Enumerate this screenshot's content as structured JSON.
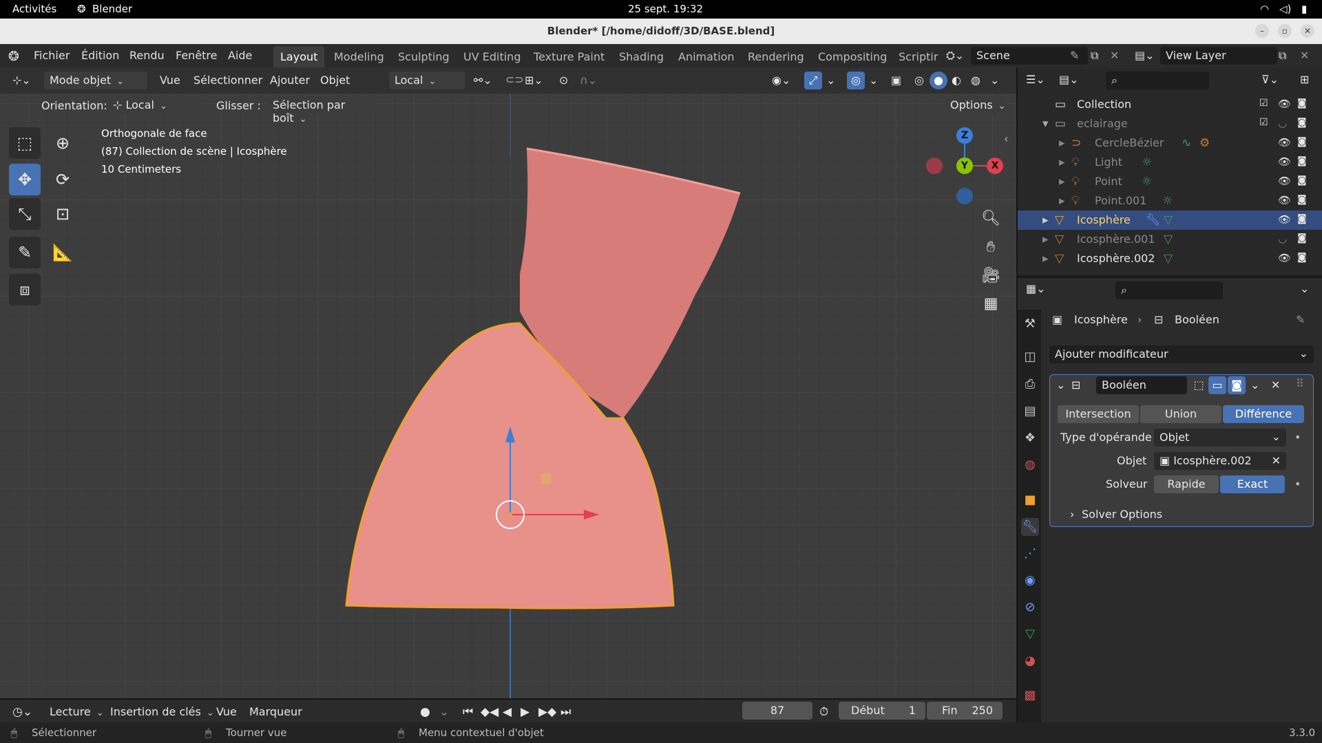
{
  "system_bar": {
    "activities": "Activités",
    "app": "Blender",
    "clock": "25 sept.  19:32"
  },
  "window": {
    "title": "Blender* [/home/didoff/3D/BASE.blend]"
  },
  "menu": {
    "items": [
      "Fichier",
      "Édition",
      "Rendu",
      "Fenêtre",
      "Aide"
    ]
  },
  "workspaces": {
    "tabs": [
      "Layout",
      "Modeling",
      "Sculpting",
      "UV Editing",
      "Texture Paint",
      "Shading",
      "Animation",
      "Rendering",
      "Compositing",
      "Scriptir"
    ],
    "active": "Layout"
  },
  "scene": {
    "name": "Scene",
    "view_layer": "View Layer"
  },
  "viewport_header": {
    "mode": "Mode objet",
    "menus": [
      "Vue",
      "Sélectionner",
      "Ajouter",
      "Objet"
    ],
    "transform_orientation": "Local",
    "orientation_label": "Orientation:",
    "orientation_value": "Local",
    "drag_label": "Glisser :",
    "drag_value": "Sélection par boît",
    "options": "Options"
  },
  "viewport_overlay": {
    "view_name": "Orthogonale de face",
    "collection_info": "(87) Collection de scène | Icosphère",
    "scale_info": "10 Centimeters"
  },
  "gizmo": {
    "z": "Z",
    "y": "Y",
    "x": "X"
  },
  "colors": {
    "accent": "#4772b3",
    "selection": "#334d80",
    "mesh": "#e8908a",
    "outline": "#f0a030",
    "axis_x": "#e04050",
    "axis_y": "#8ac400",
    "axis_z": "#3a80d8"
  },
  "outliner": {
    "rows": [
      {
        "name": "Collection",
        "icon": "collection-icon"
      },
      {
        "name": "eclairage",
        "icon": "collection-icon"
      },
      {
        "name": "CercleBézier",
        "icon": "curve-icon"
      },
      {
        "name": "Light",
        "icon": "light-icon"
      },
      {
        "name": "Point",
        "icon": "light-icon"
      },
      {
        "name": "Point.001",
        "icon": "light-icon"
      },
      {
        "name": "Icosphère",
        "icon": "mesh-icon"
      },
      {
        "name": "Icosphère.001",
        "icon": "mesh-icon"
      },
      {
        "name": "Icosphère.002",
        "icon": "mesh-icon"
      }
    ]
  },
  "properties": {
    "breadcrumb_object": "Icosphère",
    "breadcrumb_modifier": "Booléen",
    "add_modifier": "Ajouter modificateur",
    "modifier": {
      "name": "Booléen",
      "operations": [
        "Intersection",
        "Union",
        "Différence"
      ],
      "active_operation": "Différence",
      "operand_type_label": "Type d'opérande",
      "operand_type_value": "Objet",
      "object_label": "Objet",
      "object_value": "Icosphère.002",
      "solver_label": "Solveur",
      "solver_options": [
        "Rapide",
        "Exact"
      ],
      "active_solver": "Exact",
      "solver_options_label": "Solver Options"
    }
  },
  "timeline": {
    "playback": "Lecture",
    "keying": "Insertion de clés",
    "view": "Vue",
    "marker": "Marqueur",
    "current_frame": "87",
    "start_label": "Début",
    "start_value": "1",
    "end_label": "Fin",
    "end_value": "250"
  },
  "status": {
    "select": "Sélectionner",
    "rotate": "Tourner vue",
    "context_menu": "Menu contextuel d'objet",
    "version": "3.3.0"
  }
}
